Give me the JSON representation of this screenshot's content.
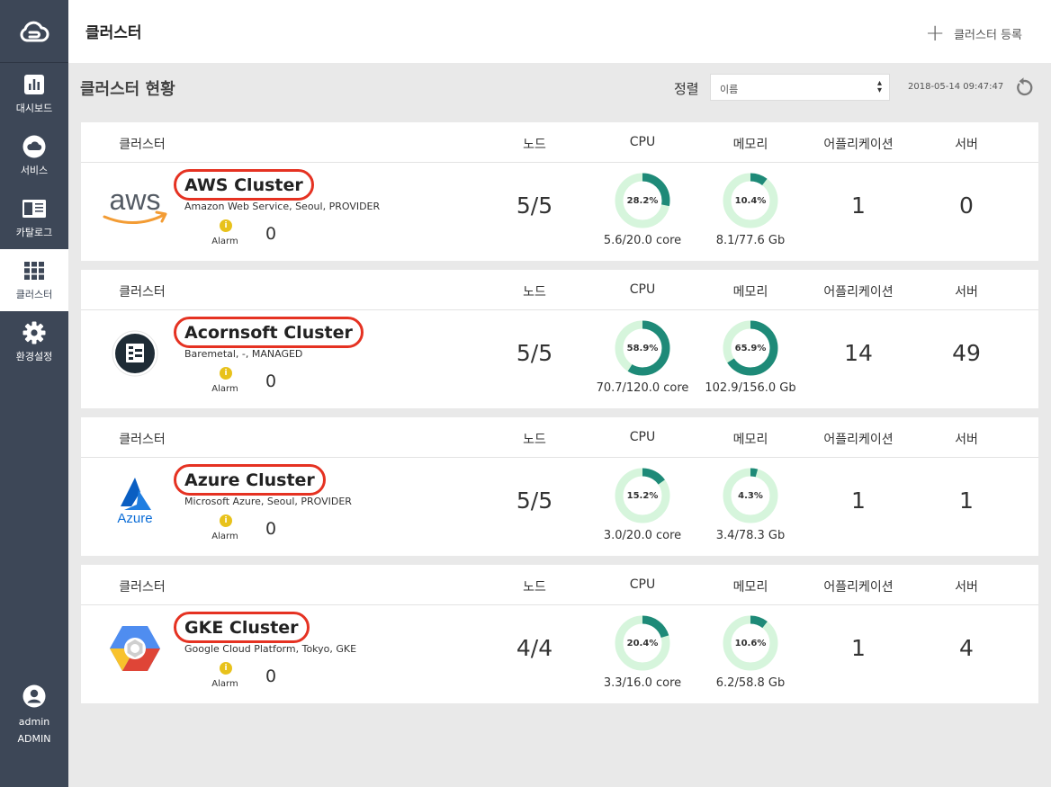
{
  "sidebar": {
    "items": [
      {
        "label": "대시보드",
        "icon": "bar-chart-icon"
      },
      {
        "label": "서비스",
        "icon": "cloud-icon"
      },
      {
        "label": "카탈로그",
        "icon": "book-icon"
      },
      {
        "label": "클러스터",
        "icon": "grid-icon"
      },
      {
        "label": "환경설정",
        "icon": "gear-icon"
      }
    ],
    "active_index": 3,
    "user": {
      "name": "admin",
      "role": "ADMIN"
    }
  },
  "header": {
    "title": "클러스터",
    "register_label": "클러스터 등록"
  },
  "toolbar": {
    "section_title": "클러스터 현황",
    "sort_label": "정렬",
    "sort_value": "이름",
    "timestamp": "2018-05-14 09:47:47"
  },
  "columns": [
    "클러스터",
    "노드",
    "CPU",
    "메모리",
    "어플리케이션",
    "서버"
  ],
  "colors": {
    "donut_fill": "#1e8a78",
    "donut_track": "#d6f5dc",
    "circle_highlight": "#e53222"
  },
  "clusters": [
    {
      "name": "AWS Cluster",
      "desc": "Amazon Web Service, Seoul, PROVIDER",
      "logo": "aws-logo",
      "alarm_label": "Alarm",
      "alarm_count": "0",
      "nodes": "5/5",
      "cpu_pct": 28.2,
      "cpu_pct_label": "28.2%",
      "cpu_usage": "5.6/20.0 core",
      "mem_pct": 10.4,
      "mem_pct_label": "10.4%",
      "mem_usage": "8.1/77.6 Gb",
      "apps": "1",
      "servers": "0"
    },
    {
      "name": "Acornsoft Cluster",
      "desc": "Baremetal, -, MANAGED",
      "logo": "baremetal-logo",
      "alarm_label": "Alarm",
      "alarm_count": "0",
      "nodes": "5/5",
      "cpu_pct": 58.9,
      "cpu_pct_label": "58.9%",
      "cpu_usage": "70.7/120.0 core",
      "mem_pct": 65.9,
      "mem_pct_label": "65.9%",
      "mem_usage": "102.9/156.0 Gb",
      "apps": "14",
      "servers": "49"
    },
    {
      "name": "Azure Cluster",
      "desc": "Microsoft Azure, Seoul, PROVIDER",
      "logo": "azure-logo",
      "logo_text": "Azure",
      "alarm_label": "Alarm",
      "alarm_count": "0",
      "nodes": "5/5",
      "cpu_pct": 15.2,
      "cpu_pct_label": "15.2%",
      "cpu_usage": "3.0/20.0 core",
      "mem_pct": 4.3,
      "mem_pct_label": "4.3%",
      "mem_usage": "3.4/78.3 Gb",
      "apps": "1",
      "servers": "1"
    },
    {
      "name": "GKE Cluster",
      "desc": "Google Cloud Platform, Tokyo, GKE",
      "logo": "gke-logo",
      "alarm_label": "Alarm",
      "alarm_count": "0",
      "nodes": "4/4",
      "cpu_pct": 20.4,
      "cpu_pct_label": "20.4%",
      "cpu_usage": "3.3/16.0 core",
      "mem_pct": 10.6,
      "mem_pct_label": "10.6%",
      "mem_usage": "6.2/58.8 Gb",
      "apps": "1",
      "servers": "4"
    }
  ]
}
